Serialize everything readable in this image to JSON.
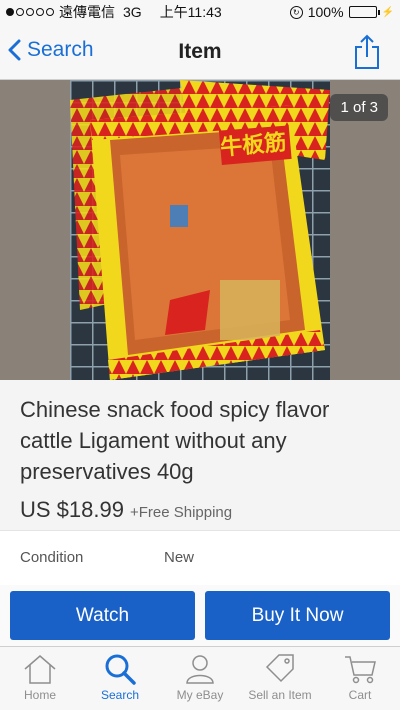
{
  "status_bar": {
    "carrier": "遠傳電信",
    "network": "3G",
    "time": "上午11:43",
    "battery": "100%"
  },
  "nav": {
    "back_label": "Search",
    "title": "Item"
  },
  "gallery": {
    "counter": "1 of 3",
    "package_text": "牛板筋"
  },
  "item": {
    "title": "Chinese snack food spicy flavor cattle Ligament without any preservatives 40g",
    "price": "US $18.99",
    "shipping": "+Free Shipping"
  },
  "specs": [
    {
      "label": "Condition",
      "value": "New"
    }
  ],
  "actions": {
    "watch": "Watch",
    "buy": "Buy It Now"
  },
  "tabs": [
    {
      "label": "Home",
      "icon": "home-icon"
    },
    {
      "label": "Search",
      "icon": "search-icon"
    },
    {
      "label": "My eBay",
      "icon": "person-icon"
    },
    {
      "label": "Sell an Item",
      "icon": "tag-icon"
    },
    {
      "label": "Cart",
      "icon": "cart-icon"
    }
  ],
  "colors": {
    "accent": "#1a6fd6",
    "button": "#1a61c7",
    "package_yellow": "#f2d81c",
    "package_red": "#d8231f"
  }
}
